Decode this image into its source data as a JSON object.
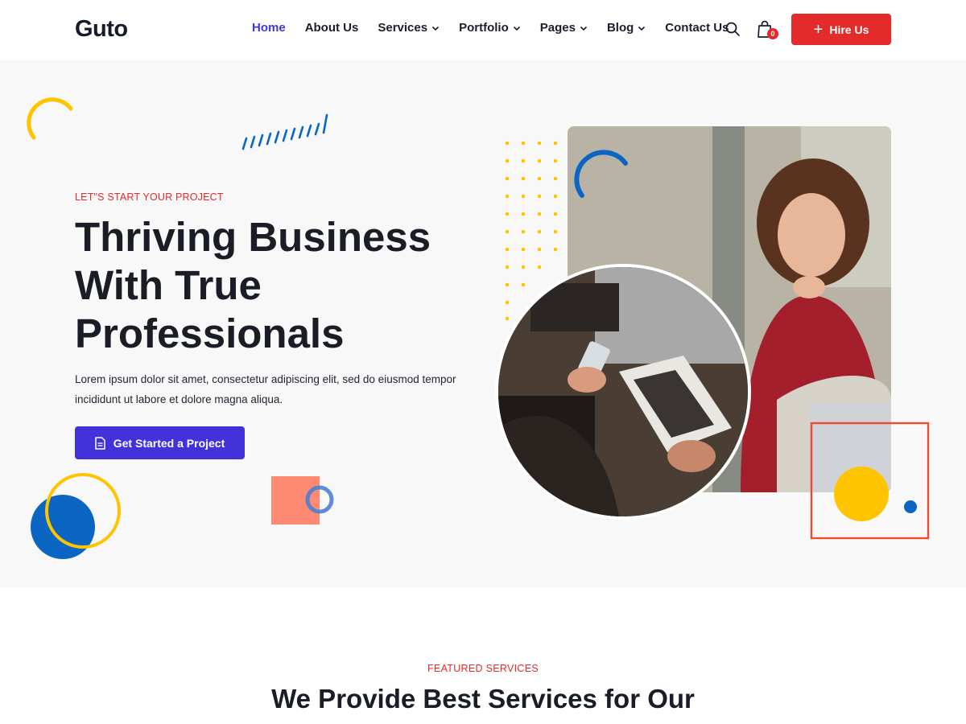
{
  "brand": {
    "logo_text": "Guto"
  },
  "nav": {
    "items": [
      {
        "label": "Home",
        "active": true,
        "has_dropdown": false
      },
      {
        "label": "About Us",
        "active": false,
        "has_dropdown": false
      },
      {
        "label": "Services",
        "active": false,
        "has_dropdown": true
      },
      {
        "label": "Portfolio",
        "active": false,
        "has_dropdown": true
      },
      {
        "label": "Pages",
        "active": false,
        "has_dropdown": true
      },
      {
        "label": "Blog",
        "active": false,
        "has_dropdown": true
      },
      {
        "label": "Contact Us",
        "active": false,
        "has_dropdown": false
      }
    ],
    "search_icon": "search-icon",
    "cart_icon": "shopping-bag-icon",
    "cart_count": "0",
    "hire_label": "Hire Us"
  },
  "hero": {
    "eyebrow": "LET\"S START YOUR PROJECT",
    "title": "Thriving Business With True Professionals",
    "description": "Lorem ipsum dolor sit amet, consectetur adipiscing elit, sed do eiusmod tempor incididunt ut labore et dolore magna aliqua.",
    "cta_label": "Get Started a Project",
    "cta_icon": "document-icon"
  },
  "services": {
    "eyebrow": "FEATURED SERVICES",
    "title": "We Provide Best Services for Our Customers Based on Needs"
  },
  "colors": {
    "accent_red": "#e32b2b",
    "accent_purple": "#4332d9",
    "accent_blue": "#0a66c2",
    "accent_yellow": "#ffc400",
    "accent_salmon": "#ff8a73",
    "hero_bg": "#f8f8f9"
  }
}
